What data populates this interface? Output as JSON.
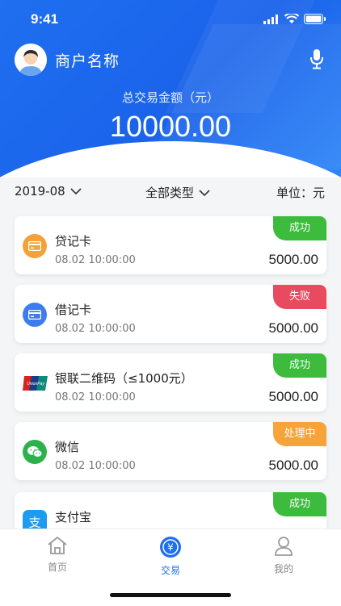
{
  "status": {
    "time": "9:41"
  },
  "header": {
    "merchant_name": "商户名称",
    "total_label": "总交易金额（元）",
    "total_amount": "10000.00"
  },
  "filters": {
    "date": "2019-08",
    "type": "全部类型",
    "unit": "单位：元"
  },
  "transactions": [
    {
      "title": "贷记卡",
      "time": "08.02   10:00:00",
      "amount": "5000.00",
      "status": "成功",
      "status_color": "#3dbb3d",
      "icon": "credit-card-icon",
      "icon_color": "#f4a13a"
    },
    {
      "title": "借记卡",
      "time": "08.02   10:00:00",
      "amount": "5000.00",
      "status": "失败",
      "status_color": "#e84a5f",
      "icon": "debit-card-icon",
      "icon_color": "#3d7cf0"
    },
    {
      "title": "银联二维码（≤1000元）",
      "time": "08.02   10:00:00",
      "amount": "5000.00",
      "status": "成功",
      "status_color": "#3dbb3d",
      "icon": "unionpay-icon",
      "icon_color": "#d7231f"
    },
    {
      "title": "微信",
      "time": "08.02   10:00:00",
      "amount": "5000.00",
      "status": "处理中",
      "status_color": "#f6a33a",
      "icon": "wechat-icon",
      "icon_color": "#2bb24c"
    },
    {
      "title": "支付宝",
      "time": "",
      "amount": "",
      "status": "成功",
      "status_color": "#3dbb3d",
      "icon": "alipay-icon",
      "icon_color": "#1f9aef"
    }
  ],
  "tabbar": {
    "home": "首页",
    "trade": "交易",
    "mine": "我的"
  },
  "colors": {
    "accent": "#1f6ff0"
  }
}
